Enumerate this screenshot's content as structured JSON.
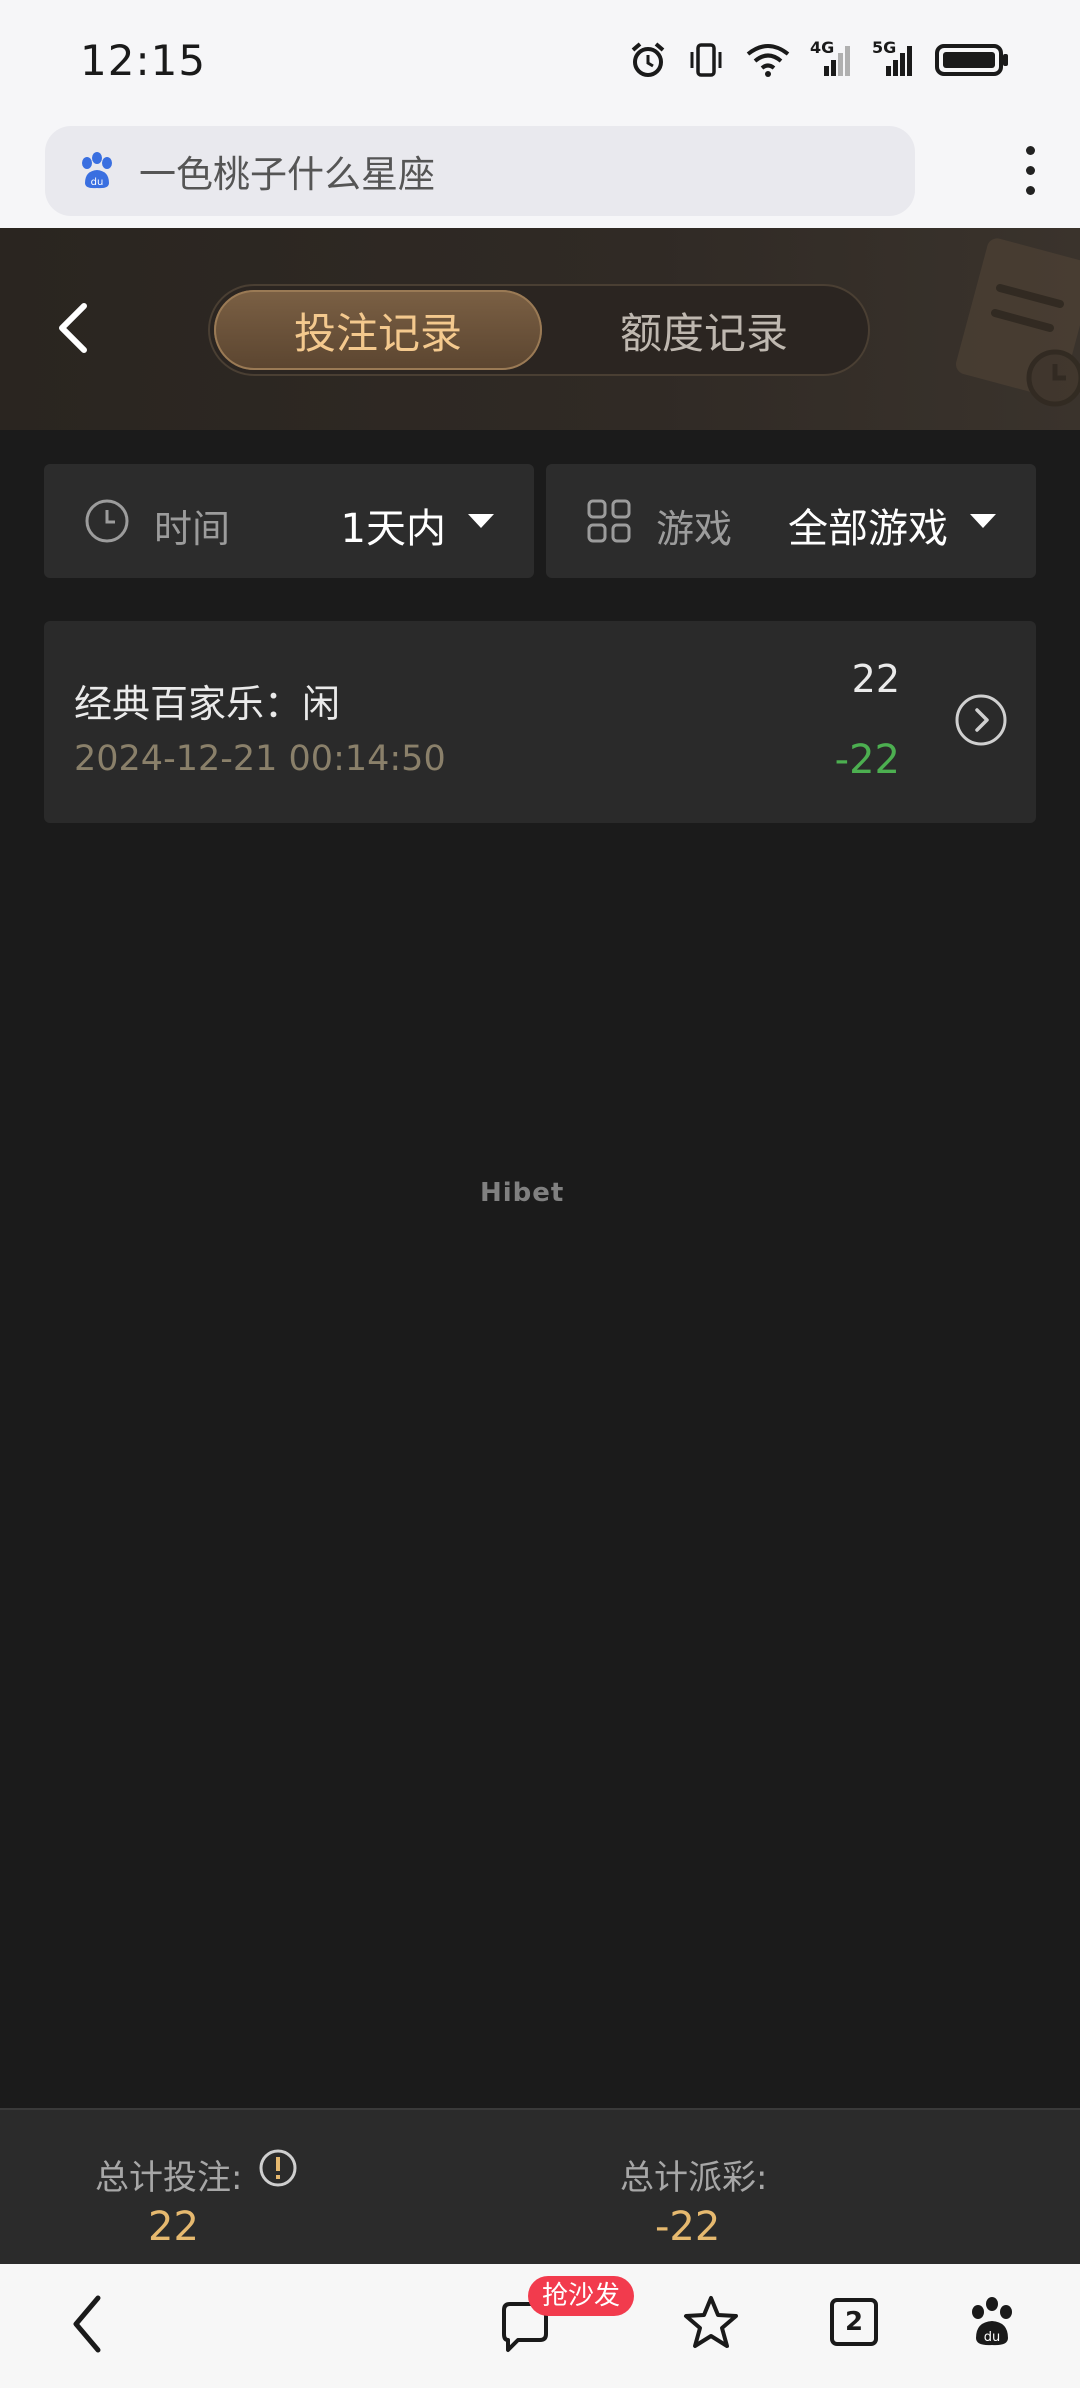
{
  "status_bar": {
    "time": "12:15",
    "icons": [
      "alarm-icon",
      "vibrate-icon",
      "wifi-icon",
      "signal-4g-icon",
      "signal-5g-icon",
      "battery-icon"
    ],
    "network_4g": "4G",
    "network_5g": "5G"
  },
  "browser": {
    "search_text": "一色桃子什么星座",
    "search_icon": "baidu-paw-icon",
    "menu_icon": "more-vertical-icon"
  },
  "header": {
    "back_icon": "chevron-left-icon",
    "tabs": [
      {
        "label": "投注记录",
        "active": true
      },
      {
        "label": "额度记录",
        "active": false
      }
    ]
  },
  "filters": {
    "time": {
      "label": "时间",
      "value": "1天内",
      "icon": "clock-icon"
    },
    "game": {
      "label": "游戏",
      "value": "全部游戏",
      "icon": "grid-icon"
    }
  },
  "records": [
    {
      "title": "经典百家乐：闲",
      "time": "2024-12-21 00:14:50",
      "bet": "22",
      "win": "-22"
    }
  ],
  "watermark": "Hibet",
  "totals": {
    "bet_label": "总计投注:",
    "bet_value": "22",
    "payout_label": "总计派彩:",
    "payout_value": "-22"
  },
  "bottom_nav": {
    "badge": "抢沙发",
    "tab_count": "2"
  },
  "colors": {
    "accent": "#f4c98e",
    "negative": "#4caf50",
    "total_value": "#e6b96f"
  }
}
